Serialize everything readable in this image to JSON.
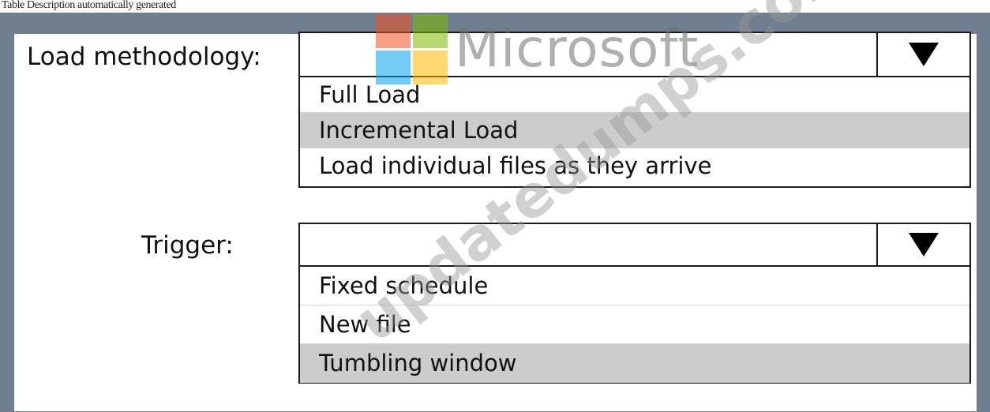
{
  "caption": "Table Description automatically generated",
  "load_methodology": {
    "label": "Load methodology:",
    "selected": "",
    "options": [
      "Full Load",
      "Incremental Load",
      "Load individual files as they arrive"
    ],
    "highlighted_index": 1
  },
  "trigger": {
    "label": "Trigger:",
    "selected": "",
    "options": [
      "Fixed schedule",
      "New file",
      "Tumbling window"
    ],
    "highlighted_index": 2
  },
  "watermark": {
    "brand": "Microsoft",
    "site": "updatedumps.com"
  },
  "colors": {
    "frame": "#6f7f8f",
    "highlight": "#cccccc",
    "logo_red": "#f25022",
    "logo_green": "#7fba00",
    "logo_blue": "#00a4ef",
    "logo_yellow": "#ffb900"
  },
  "icons": {
    "dropdown_arrow": "triangle-down-icon"
  }
}
